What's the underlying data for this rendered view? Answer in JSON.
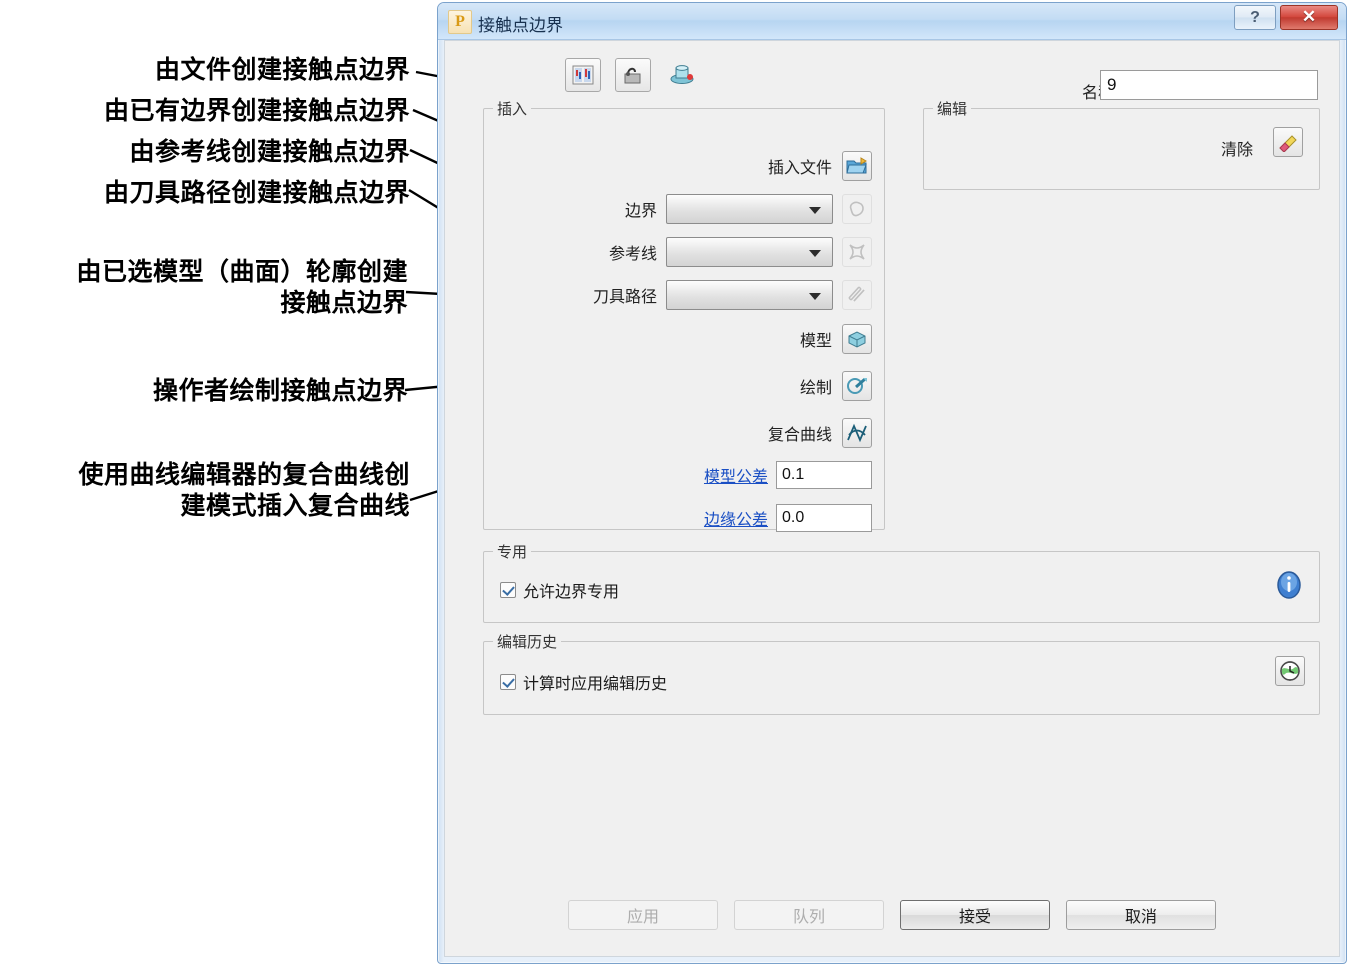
{
  "window": {
    "title": "接触点边界",
    "app_icon_letter": "P",
    "help_button": "?",
    "close_button": "✕"
  },
  "toolbar": {
    "buttons": [
      {
        "name": "compare-icon",
        "label": ""
      },
      {
        "name": "pick-surface-icon",
        "label": ""
      },
      {
        "name": "tool-icon",
        "label": ""
      }
    ]
  },
  "name_field": {
    "label": "名称",
    "value": "9"
  },
  "insert_group": {
    "title": "插入",
    "file_row": {
      "label": "插入文件",
      "icon": "open-folder-icon"
    },
    "combo_rows": [
      {
        "label": "边界",
        "value": "",
        "icon": "boundary-icon",
        "enabled": false
      },
      {
        "label": "参考线",
        "value": "",
        "icon": "pattern-icon",
        "enabled": false
      },
      {
        "label": "刀具路径",
        "value": "",
        "icon": "toolpath-icon",
        "enabled": false
      }
    ],
    "action_rows": [
      {
        "label": "模型",
        "icon": "model-cube-icon"
      },
      {
        "label": "绘制",
        "icon": "sketch-pen-icon"
      },
      {
        "label": "复合曲线",
        "icon": "composite-curve-icon"
      }
    ],
    "tolerances": [
      {
        "label": "模型公差",
        "value": "0.1"
      },
      {
        "label": "边缘公差",
        "value": "0.0"
      }
    ]
  },
  "edit_group": {
    "title": "编辑",
    "clear_label": "清除",
    "clear_icon": "eraser-icon"
  },
  "special_group": {
    "title": "专用",
    "checkbox_label": "允许边界专用",
    "checked": true,
    "info_icon": "info-icon"
  },
  "history_group": {
    "title": "编辑历史",
    "checkbox_label": "计算时应用编辑历史",
    "checked": true,
    "history_icon": "clock-globe-icon"
  },
  "footer_buttons": [
    {
      "label": "应用",
      "enabled": false
    },
    {
      "label": "队列",
      "enabled": false
    },
    {
      "label": "接受",
      "enabled": true
    },
    {
      "label": "取消",
      "enabled": true
    }
  ],
  "annotations": [
    {
      "text": "由文件创建接触点边界"
    },
    {
      "text": "由已有边界创建接触点边界"
    },
    {
      "text": "由参考线创建接触点边界"
    },
    {
      "text": "由刀具路径创建接触点边界"
    },
    {
      "text": "由已选模型（曲面）轮廓创建\n接触点边界"
    },
    {
      "text": "操作者绘制接触点边界"
    },
    {
      "text": "使用曲线编辑器的复合曲线创\n建模式插入复合曲线"
    }
  ],
  "colors": {
    "title_bar": "#c3dcf4",
    "close_button": "#c0392f",
    "link": "#1a4fc4",
    "dialog_bg": "#f0f0f0",
    "border": "#7ba2cc"
  }
}
